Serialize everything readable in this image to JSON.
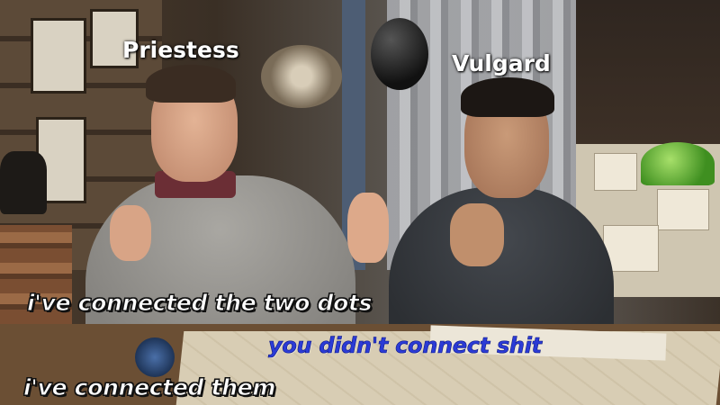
{
  "captions": {
    "speaker_left": "Priestess",
    "speaker_right": "Vulgard"
  },
  "subtitles": {
    "line1": "i've connected the two dots",
    "line2": "you didn't connect shit",
    "line3": "i've  connected them"
  },
  "colors": {
    "subtitle_white": "#ffffff",
    "subtitle_blue": "#2b3bd6",
    "outline": "#111111"
  }
}
